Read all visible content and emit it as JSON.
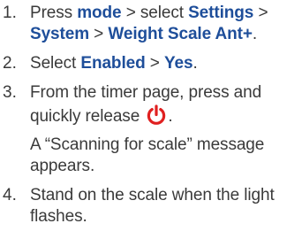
{
  "colors": {
    "text": "#3a3a3a",
    "keyword": "#1e4e9a",
    "icon": "#e02020"
  },
  "steps": [
    {
      "number": "1.",
      "press": "Press ",
      "mode": "mode",
      "select": " > select ",
      "settings": "Settings",
      "sep1": " > ",
      "system": "System",
      "sep2": " > ",
      "weight_scale": "Weight Scale Ant+",
      "end": "."
    },
    {
      "number": "2.",
      "select": "Select ",
      "enabled": "Enabled",
      "sep": " > ",
      "yes": "Yes",
      "end": "."
    },
    {
      "number": "3.",
      "text": "From the timer page, press and quickly release ",
      "icon": "power-icon",
      "end": ".",
      "note": "A “Scanning for scale” message appears."
    },
    {
      "number": "4.",
      "text": "Stand on the scale when the light flashes."
    }
  ]
}
